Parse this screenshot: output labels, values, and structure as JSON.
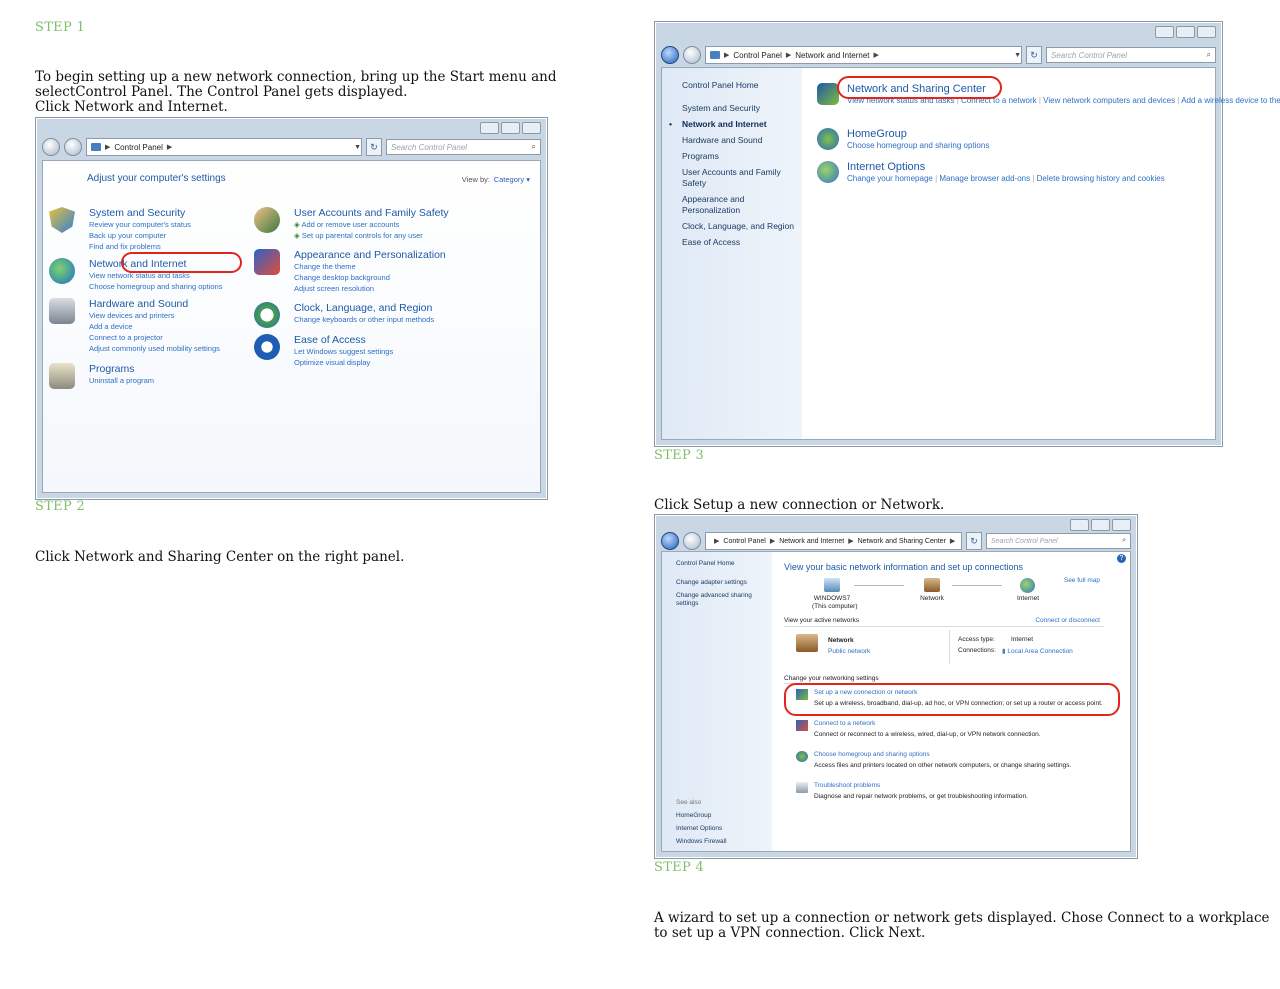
{
  "steps": {
    "s1": "STEP 1",
    "s2": "STEP 2",
    "s3": "STEP 3",
    "s4": "STEP 4"
  },
  "instructions": {
    "i1_l1": "To begin setting up a new network connection, bring up the Start menu and",
    "i1_l2": "selectControl Panel. The Control Panel gets displayed.",
    "i1_l3": "Click Network and Internet.",
    "i2": "Click Network and Sharing Center on the right panel.",
    "i3": "Click Setup a new connection or Network.",
    "i4_l1": "A wizard to set up a connection or network gets displayed. Chose Connect to a workplace",
    "i4_l2": "to set up a VPN connection. Click Next."
  },
  "shot1": {
    "breadcrumb": [
      "Control Panel"
    ],
    "search_placeholder": "Search Control Panel",
    "heading": "Adjust your computer's settings",
    "viewby_label": "View by:",
    "viewby_value": "Category",
    "left": [
      {
        "title": "System and Security",
        "links": [
          "Review your computer's status",
          "Back up your computer",
          "Find and fix problems"
        ]
      },
      {
        "title": "Network and Internet",
        "links": [
          "View network status and tasks",
          "Choose homegroup and sharing options"
        ]
      },
      {
        "title": "Hardware and Sound",
        "links": [
          "View devices and printers",
          "Add a device",
          "Connect to a projector",
          "Adjust commonly used mobility settings"
        ]
      },
      {
        "title": "Programs",
        "links": [
          "Uninstall a program"
        ]
      }
    ],
    "right": [
      {
        "title": "User Accounts and Family Safety",
        "links": [
          "Add or remove user accounts",
          "Set up parental controls for any user"
        ]
      },
      {
        "title": "Appearance and Personalization",
        "links": [
          "Change the theme",
          "Change desktop background",
          "Adjust screen resolution"
        ]
      },
      {
        "title": "Clock, Language, and Region",
        "links": [
          "Change keyboards or other input methods"
        ]
      },
      {
        "title": "Ease of Access",
        "links": [
          "Let Windows suggest settings",
          "Optimize visual display"
        ]
      }
    ]
  },
  "shot3": {
    "breadcrumb": [
      "Control Panel",
      "Network and Internet"
    ],
    "search_placeholder": "Search Control Panel",
    "sidebar": [
      "Control Panel Home",
      "System and Security",
      "Network and Internet",
      "Hardware and Sound",
      "Programs",
      "User Accounts and Family Safety",
      "Appearance and Personalization",
      "Clock, Language, and Region",
      "Ease of Access"
    ],
    "groups": [
      {
        "title": "Network and Sharing Center",
        "links": [
          "View network status and tasks",
          "Connect to a network",
          "View network computers and devices",
          "Add a wireless device to the network"
        ]
      },
      {
        "title": "HomeGroup",
        "links": [
          "Choose homegroup and sharing options"
        ]
      },
      {
        "title": "Internet Options",
        "links": [
          "Change your homepage",
          "Manage browser add-ons",
          "Delete browsing history and cookies"
        ]
      }
    ]
  },
  "shot4": {
    "breadcrumb": [
      "Control Panel",
      "Network and Internet",
      "Network and Sharing Center"
    ],
    "search_placeholder": "Search Control Panel",
    "sidebar": [
      "Control Panel Home",
      "Change adapter settings",
      "Change advanced sharing settings"
    ],
    "see_also_label": "See also",
    "see_also": [
      "HomeGroup",
      "Internet Options",
      "Windows Firewall"
    ],
    "title": "View your basic network information and set up connections",
    "see_full_map": "See full map",
    "map": {
      "computer": "WINDOWS7",
      "computer_sub": "(This computer)",
      "network": "Network",
      "internet": "Internet"
    },
    "active_label": "View your active networks",
    "connect_disconnect": "Connect or disconnect",
    "net_name": "Network",
    "net_type": "Public network",
    "access_type_label": "Access type:",
    "access_type_value": "Internet",
    "connections_label": "Connections:",
    "connections_value": "Local Area Connection",
    "change_label": "Change your networking settings",
    "tasks": [
      {
        "title": "Set up a new connection or network",
        "desc": "Set up a wireless, broadband, dial-up, ad hoc, or VPN connection; or set up a router or access point."
      },
      {
        "title": "Connect to a network",
        "desc": "Connect or reconnect to a wireless, wired, dial-up, or VPN network connection."
      },
      {
        "title": "Choose homegroup and sharing options",
        "desc": "Access files and printers located on other network computers, or change sharing settings."
      },
      {
        "title": "Troubleshoot problems",
        "desc": "Diagnose and repair network problems, or get troubleshooting information."
      }
    ]
  }
}
